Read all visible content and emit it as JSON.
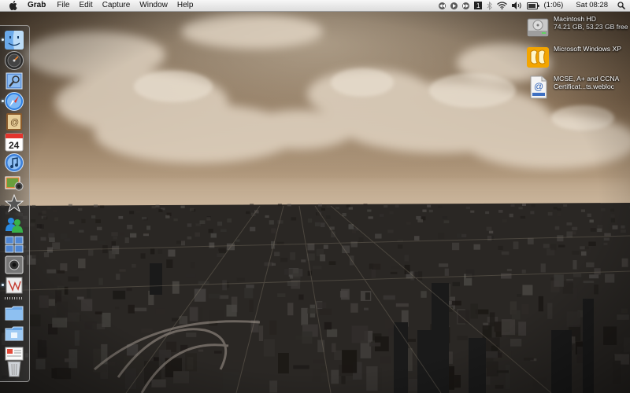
{
  "menubar": {
    "app_name": "Grab",
    "menus": [
      "File",
      "Edit",
      "Capture",
      "Window",
      "Help"
    ],
    "battery_text": "(1:06)",
    "clock": "Sat 08:28",
    "tray_icons": [
      "rewind-icon",
      "play-icon",
      "forward-icon",
      "record-icon",
      "bluetooth-icon",
      "wifi-icon",
      "volume-icon",
      "battery-icon",
      "spotlight-icon"
    ]
  },
  "desktop": {
    "icons": [
      {
        "title": "Macintosh HD",
        "subtitle": "74.21 GB, 53.23 GB free",
        "icon": "hard-drive-icon"
      },
      {
        "title": "Microsoft Windows XP",
        "subtitle": "",
        "icon": "parallels-vm-icon"
      },
      {
        "title": "MCSE, A+ and CCNA Certificat...ts.webloc",
        "subtitle": "",
        "icon": "webloc-file-icon"
      }
    ]
  },
  "dock": {
    "items": [
      {
        "name": "Finder",
        "icon": "finder-icon",
        "running": true
      },
      {
        "name": "Dashboard",
        "icon": "dashboard-icon",
        "running": false
      },
      {
        "name": "Preview",
        "icon": "preview-icon",
        "running": false
      },
      {
        "name": "Safari",
        "icon": "safari-icon",
        "running": true
      },
      {
        "name": "Address Book",
        "icon": "address-book-icon",
        "running": false
      },
      {
        "name": "iCal",
        "icon": "ical-icon",
        "running": false,
        "date": "24"
      },
      {
        "name": "iTunes",
        "icon": "itunes-icon",
        "running": false
      },
      {
        "name": "iPhoto",
        "icon": "iphoto-icon",
        "running": false
      },
      {
        "name": "iMovie",
        "icon": "imovie-icon",
        "running": false
      },
      {
        "name": "MSN Messenger",
        "icon": "messenger-icon",
        "running": false
      },
      {
        "name": "Spaces",
        "icon": "spaces-icon",
        "running": false
      },
      {
        "name": "Grab",
        "icon": "grab-icon",
        "running": false
      },
      {
        "name": "Parallels",
        "icon": "parallels-icon",
        "running": true
      },
      {
        "name": "Applications",
        "icon": "applications-folder-icon",
        "running": false
      },
      {
        "name": "Documents",
        "icon": "documents-folder-icon",
        "running": false
      },
      {
        "name": "Mail",
        "icon": "mail-icon",
        "running": false
      },
      {
        "name": "Trash",
        "icon": "trash-icon",
        "running": false
      }
    ]
  },
  "colors": {
    "menubar_bg": "#e6e6e6",
    "sky_top": "#5a4632",
    "sky_horizon": "#cdb79c",
    "city_dark": "#1c1c1c"
  }
}
